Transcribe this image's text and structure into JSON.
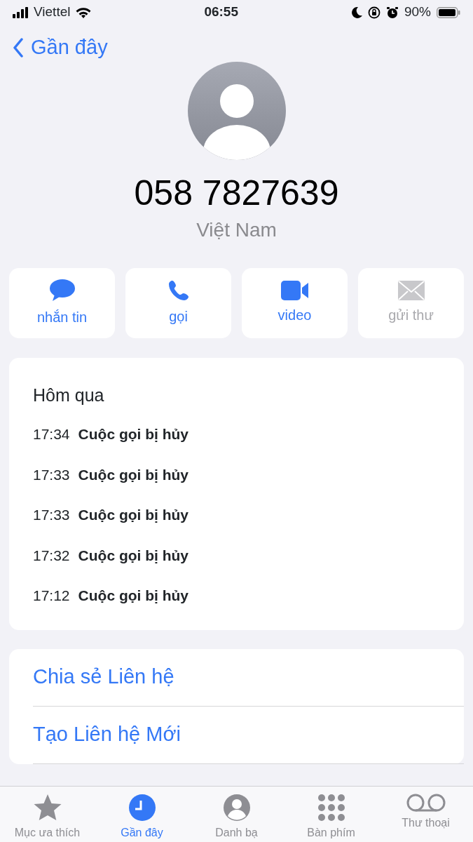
{
  "status_bar": {
    "carrier": "Viettel",
    "time": "06:55",
    "battery": "90%"
  },
  "nav": {
    "back": "Gần đây"
  },
  "contact": {
    "number": "058 7827639",
    "country": "Việt Nam"
  },
  "actions": [
    {
      "kind": "message",
      "label": "nhắn tin",
      "disabled": false
    },
    {
      "kind": "call",
      "label": "gọi",
      "disabled": false
    },
    {
      "kind": "video",
      "label": "video",
      "disabled": false
    },
    {
      "kind": "mail",
      "label": "gửi thư",
      "disabled": true
    }
  ],
  "calls": {
    "heading": "Hôm qua",
    "items": [
      {
        "time": "17:34",
        "status": "Cuộc gọi bị hủy"
      },
      {
        "time": "17:33",
        "status": "Cuộc gọi bị hủy"
      },
      {
        "time": "17:33",
        "status": "Cuộc gọi bị hủy"
      },
      {
        "time": "17:32",
        "status": "Cuộc gọi bị hủy"
      },
      {
        "time": "17:12",
        "status": "Cuộc gọi bị hủy"
      }
    ]
  },
  "links": [
    "Chia sẻ Liên hệ",
    "Tạo Liên hệ Mới"
  ],
  "tabs": [
    {
      "kind": "favorites",
      "label": "Mục ưa thích",
      "selected": false
    },
    {
      "kind": "recents",
      "label": "Gần đây",
      "selected": true
    },
    {
      "kind": "contacts",
      "label": "Danh bạ",
      "selected": false
    },
    {
      "kind": "keypad",
      "label": "Bàn phím",
      "selected": false
    },
    {
      "kind": "voicemail",
      "label": "Thư thoại",
      "selected": false
    }
  ]
}
